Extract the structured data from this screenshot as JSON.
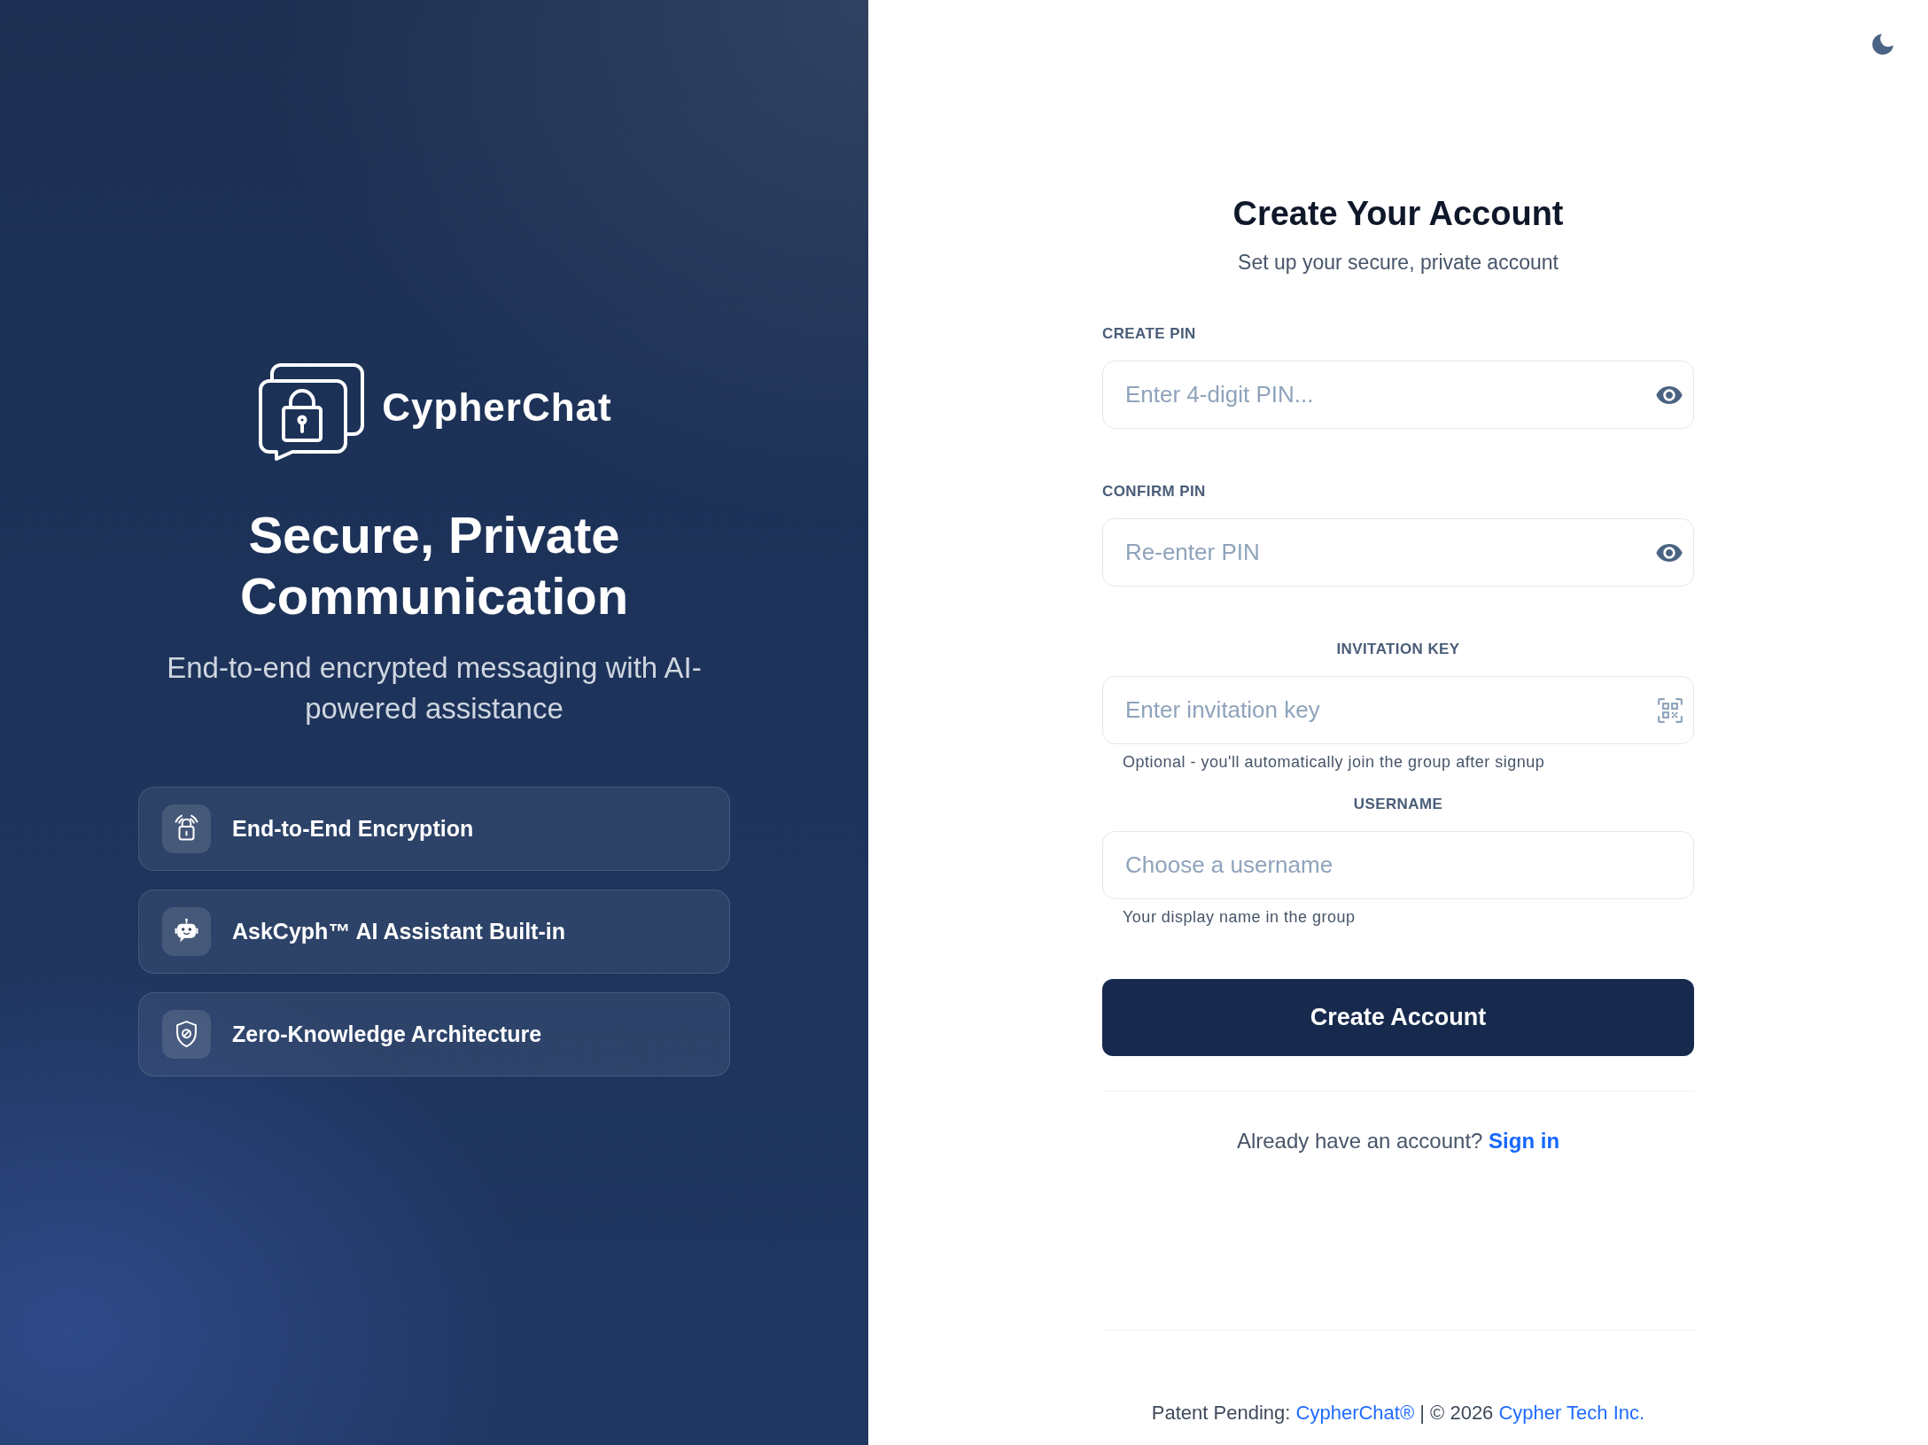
{
  "brand": {
    "name": "CypherChat"
  },
  "hero": {
    "title": "Secure, Private Communication",
    "subtitle": "End-to-end encrypted messaging with AI-powered assistance"
  },
  "features": [
    {
      "kind": "lock",
      "label": "End-to-End Encryption"
    },
    {
      "kind": "robot",
      "label": "AskCyph™ AI Assistant Built-in"
    },
    {
      "kind": "shield",
      "label": "Zero-Knowledge Architecture"
    }
  ],
  "form": {
    "title": "Create Your Account",
    "subtitle": "Set up your secure, private account",
    "fields": [
      {
        "kind": "pin",
        "label": "CREATE PIN",
        "placeholder": "Enter 4-digit PIN..."
      },
      {
        "kind": "pin",
        "label": "CONFIRM PIN",
        "placeholder": "Re-enter PIN"
      },
      {
        "kind": "key",
        "label": "INVITATION KEY",
        "placeholder": "Enter invitation key",
        "hint": "Optional - you'll automatically join the group after signup"
      },
      {
        "kind": "text",
        "label": "USERNAME",
        "placeholder": "Choose a username",
        "hint": "Your display name in the group"
      }
    ],
    "submit": "Create Account",
    "sign_in": {
      "prompt": "Already have an account?",
      "link": "Sign in"
    }
  },
  "footer": {
    "parts": [
      {
        "kind": "text",
        "text": "Patent Pending:"
      },
      {
        "kind": "link",
        "text": "CypherChat®"
      },
      {
        "kind": "text",
        "text": "| © 2026"
      },
      {
        "kind": "link",
        "text": "Cypher Tech Inc."
      }
    ]
  }
}
